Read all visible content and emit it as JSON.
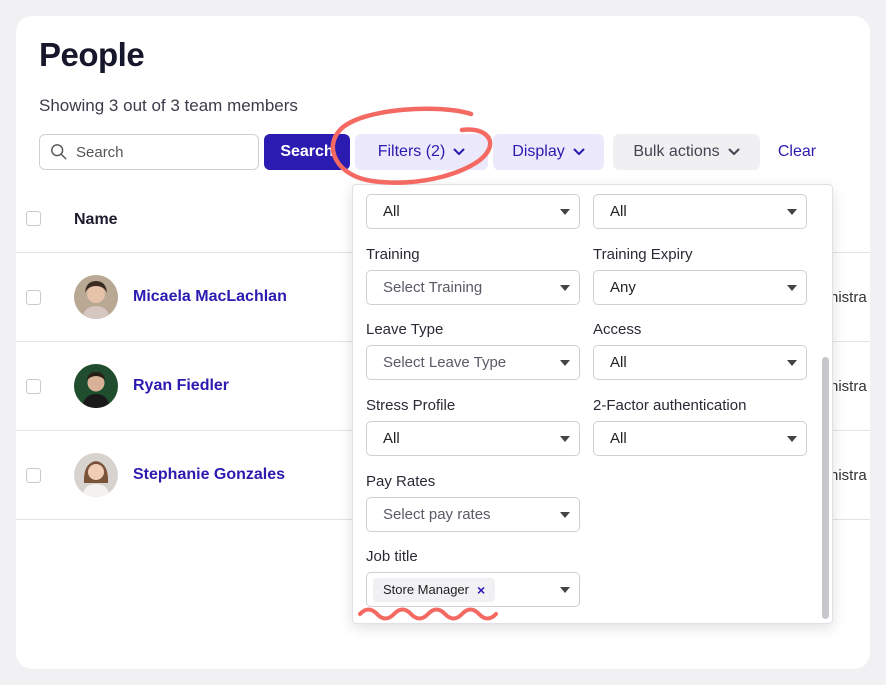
{
  "page": {
    "title": "People",
    "subtitle": "Showing 3 out of 3 team members"
  },
  "toolbar": {
    "search_placeholder": "Search",
    "search_button": "Search",
    "filters_button": "Filters (2)",
    "display_button": "Display",
    "bulk_button": "Bulk actions",
    "clear_button": "Clear"
  },
  "table": {
    "columns": [
      "Name"
    ],
    "rows": [
      {
        "name": "Micaela MacLachlan",
        "role_partial": "nistra"
      },
      {
        "name": "Ryan Fiedler",
        "role_partial": "nistra"
      },
      {
        "name": "Stephanie Gonzales",
        "role_partial": "nistra"
      }
    ]
  },
  "filters": {
    "row0": {
      "left_value": "All",
      "right_value": "All"
    },
    "training": {
      "label": "Training",
      "value": "Select Training"
    },
    "training_expiry": {
      "label": "Training Expiry",
      "value": "Any"
    },
    "leave_type": {
      "label": "Leave Type",
      "value": "Select Leave Type"
    },
    "access": {
      "label": "Access",
      "value": "All"
    },
    "stress_profile": {
      "label": "Stress Profile",
      "value": "All"
    },
    "two_factor": {
      "label": "2-Factor authentication",
      "value": "All"
    },
    "pay_rates": {
      "label": "Pay Rates",
      "value": "Select pay rates"
    },
    "job_title": {
      "label": "Job title",
      "tag": "Store Manager",
      "tag_remove": "×"
    }
  },
  "colors": {
    "accent": "#2b1bb0",
    "accent_soft": "#ebe9fb",
    "annotation": "#f46a62"
  },
  "icons": [
    "search-icon",
    "chevron-down-icon",
    "caret-down-icon",
    "close-icon"
  ]
}
